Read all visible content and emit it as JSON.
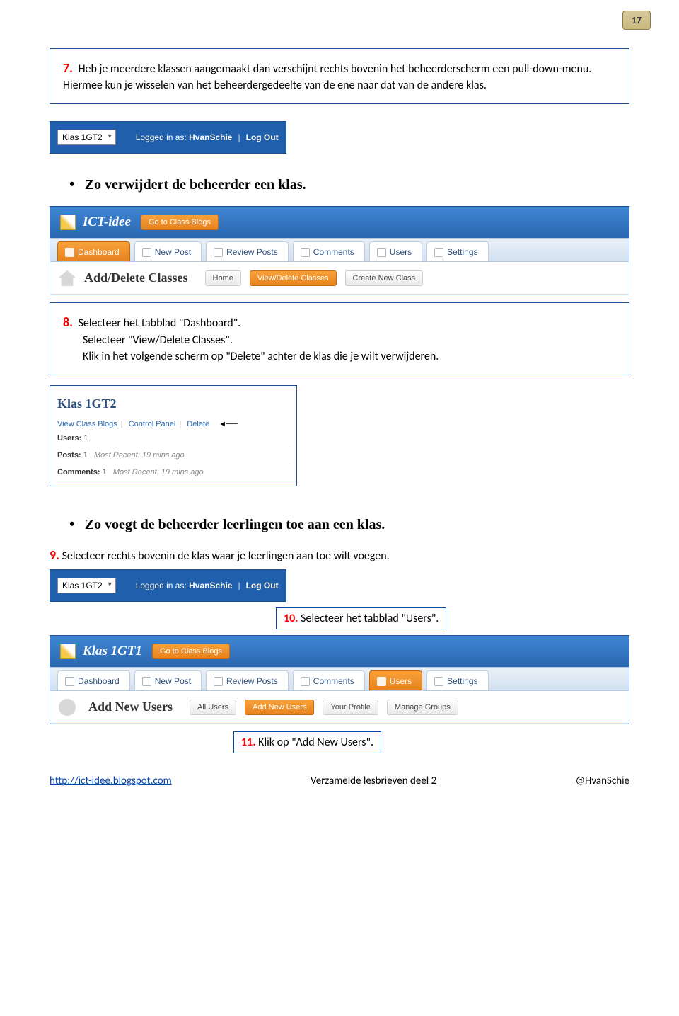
{
  "page_number": "17",
  "step7": {
    "num": "7.",
    "text": "Heb je meerdere klassen aangemaakt dan verschijnt rechts bovenin het beheerderscherm een pull-down-menu. Hiermee kun je wisselen van het beheerdergedeelte van de ene naar dat van de andere klas."
  },
  "bluebar1": {
    "klas": "Klas 1GT2",
    "logged_lbl": "Logged in as:",
    "user": "HvanSchie",
    "logout": "Log Out"
  },
  "bullet1": "Zo verwijdert de beheerder een klas.",
  "dash1": {
    "brand": "ICT-idee",
    "goto": "Go to Class Blogs",
    "tabs": [
      "Dashboard",
      "New Post",
      "Review Posts",
      "Comments",
      "Users",
      "Settings"
    ],
    "active_tab": 0,
    "subtitle": "Add/Delete Classes",
    "subnav": [
      "Home",
      "View/Delete Classes",
      "Create New Class"
    ],
    "subnav_active": 1
  },
  "step8": {
    "num": "8.",
    "l1": "Selecteer het tabblad \"Dashboard\".",
    "l2": "Selecteer \"View/Delete Classes\".",
    "l3": "Klik in het volgende scherm op \"Delete\" achter de klas die je wilt verwijderen."
  },
  "klas_panel": {
    "title": "Klas 1GT2",
    "links": [
      "View Class Blogs",
      "Control Panel",
      "Delete"
    ],
    "users_lbl": "Users:",
    "users_val": "1",
    "posts_lbl": "Posts:",
    "posts_val": "1",
    "posts_recent": "Most Recent: 19 mins ago",
    "comments_lbl": "Comments:",
    "comments_val": "1",
    "comments_recent": "Most Recent: 19 mins ago"
  },
  "bullet2": "Zo voegt de beheerder leerlingen toe aan een klas.",
  "step9": {
    "num": "9.",
    "text": "Selecteer rechts bovenin de klas waar je leerlingen aan toe wilt voegen."
  },
  "bluebar2": {
    "klas": "Klas 1GT2",
    "logged_lbl": "Logged in as:",
    "user": "HvanSchie",
    "logout": "Log Out"
  },
  "note10": {
    "num": "10.",
    "text": "Selecteer het tabblad \"Users\"."
  },
  "dash2": {
    "brand": "Klas 1GT1",
    "goto": "Go to Class Blogs",
    "tabs": [
      "Dashboard",
      "New Post",
      "Review Posts",
      "Comments",
      "Users",
      "Settings"
    ],
    "active_tab": 4,
    "subtitle": "Add New Users",
    "subnav": [
      "All Users",
      "Add New Users",
      "Your Profile",
      "Manage Groups"
    ],
    "subnav_active": 1
  },
  "note11": {
    "num": "11.",
    "text": "Klik op \"Add New Users\"."
  },
  "footer": {
    "left_url": "http://ict-idee.blogspot.com",
    "center": "Verzamelde lesbrieven  deel 2",
    "right": "@HvanSchie"
  }
}
